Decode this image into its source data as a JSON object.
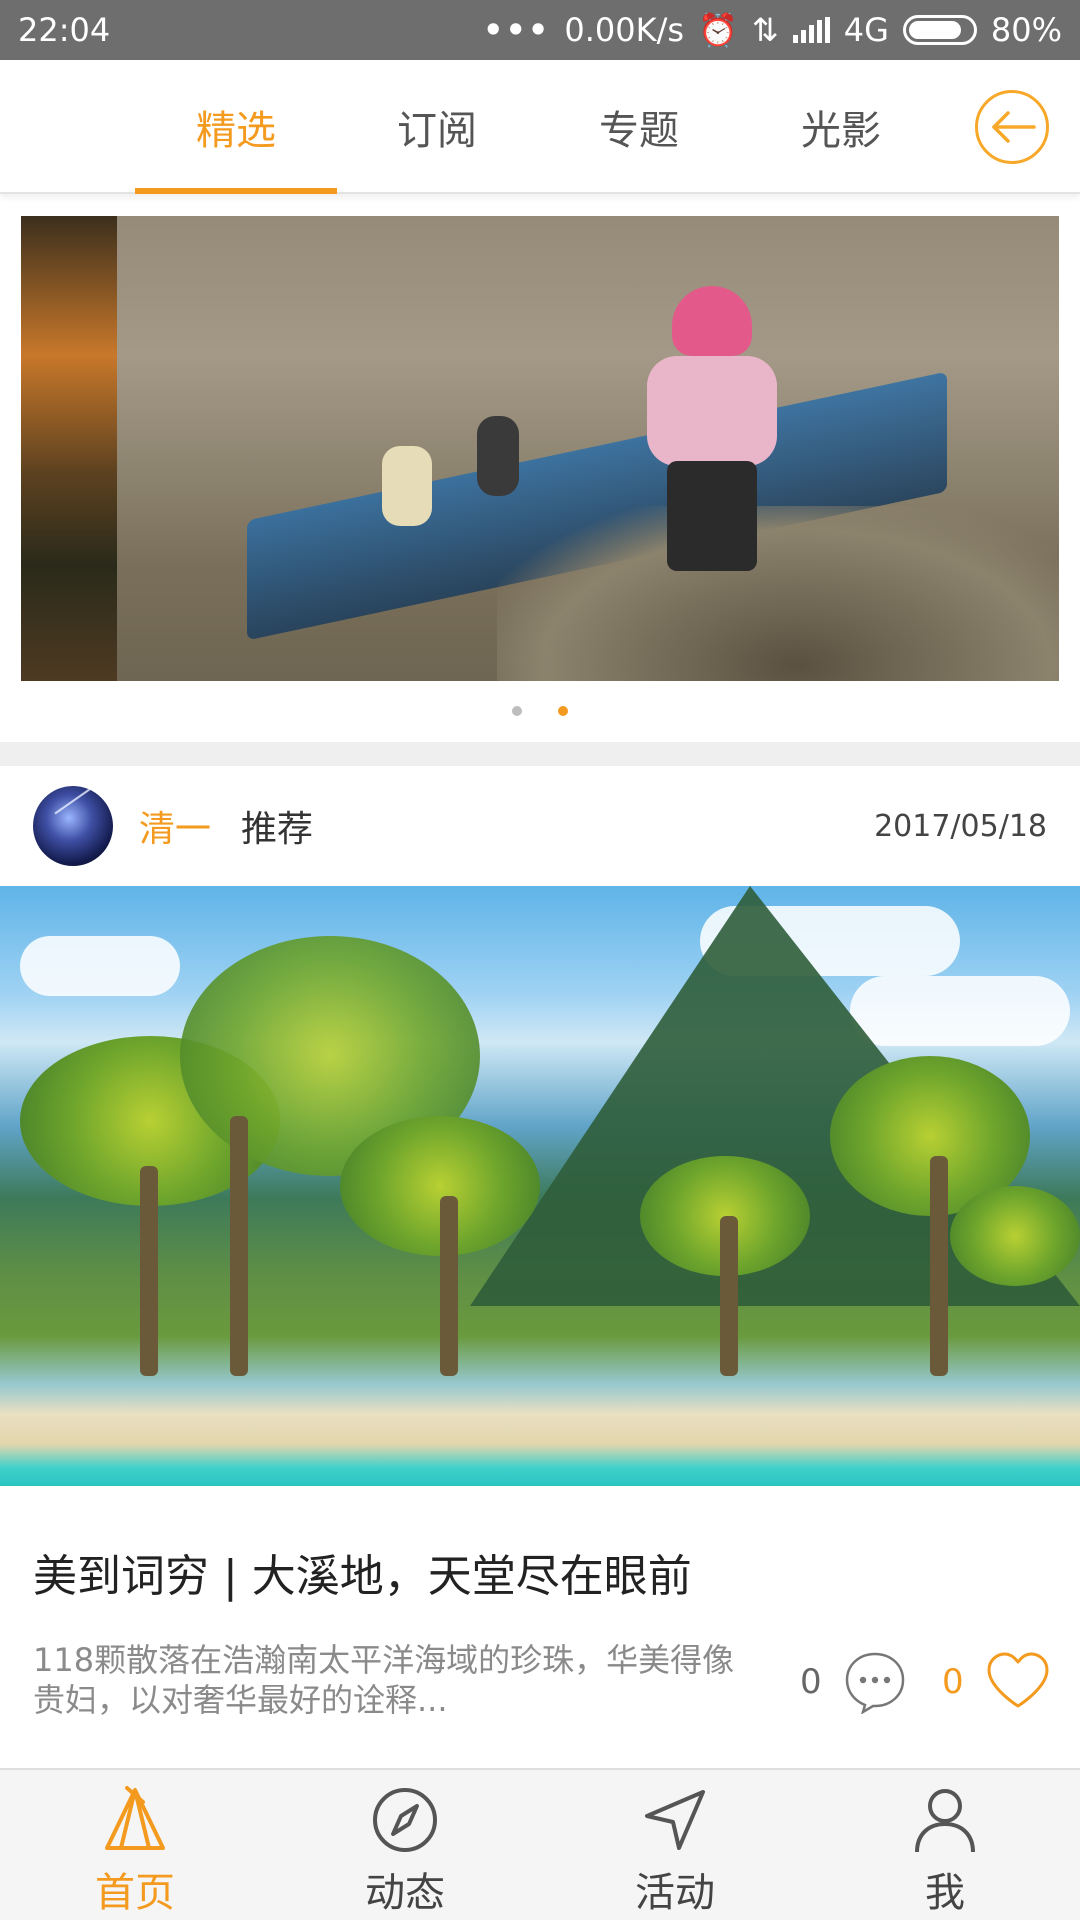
{
  "status_bar": {
    "time": "22:04",
    "net_speed": "0.00K/s",
    "network": "4G",
    "battery": "80%"
  },
  "top_tabs": {
    "items": [
      {
        "label": "精选",
        "active": true
      },
      {
        "label": "订阅",
        "active": false
      },
      {
        "label": "专题",
        "active": false
      },
      {
        "label": "光影",
        "active": false
      }
    ],
    "back_icon": "arrow-left-circle-icon"
  },
  "banner": {
    "page_count": 2,
    "active_index": 1
  },
  "post": {
    "author": "清一",
    "tag": "推荐",
    "date": "2017/05/18",
    "title": "美到词穷 | 大溪地，天堂尽在眼前",
    "excerpt": "118颗散落在浩瀚南太平洋海域的珍珠，华美得像贵妇，以对奢华最好的诠释...",
    "comment_count": "0",
    "like_count": "0"
  },
  "bottom_nav": {
    "items": [
      {
        "label": "首页",
        "icon": "tent-icon",
        "active": true
      },
      {
        "label": "动态",
        "icon": "compass-icon",
        "active": false
      },
      {
        "label": "活动",
        "icon": "send-arrow-icon",
        "active": false
      },
      {
        "label": "我",
        "icon": "user-icon",
        "active": false
      }
    ]
  },
  "colors": {
    "accent": "#f39a1f",
    "status_bar": "#6e6e6e",
    "nav_bg": "#f5f5f5"
  }
}
